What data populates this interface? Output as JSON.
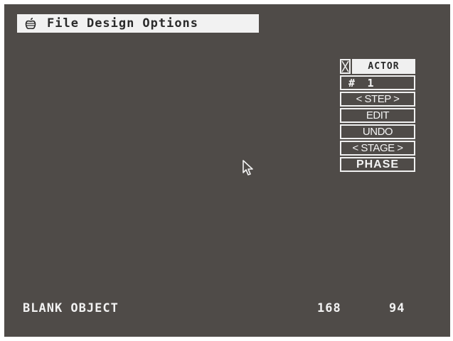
{
  "menubar": {
    "icon": "apple-icon",
    "items": [
      "File",
      "Design",
      "Options"
    ]
  },
  "panel": {
    "title": "ACTOR",
    "close_icon": "close-box-icon",
    "actor_prefix": "#",
    "actor_number": "1",
    "step": "< STEP >",
    "edit": "EDIT",
    "undo": "UNDO",
    "stage": "< STAGE >",
    "phase": "PHASE"
  },
  "status": {
    "label": "BLANK OBJECT",
    "x": "168",
    "y": "94"
  },
  "colors": {
    "background": "#4f4b48",
    "menubar": "#f2f2f2",
    "foreground": "#f0f0f0"
  }
}
